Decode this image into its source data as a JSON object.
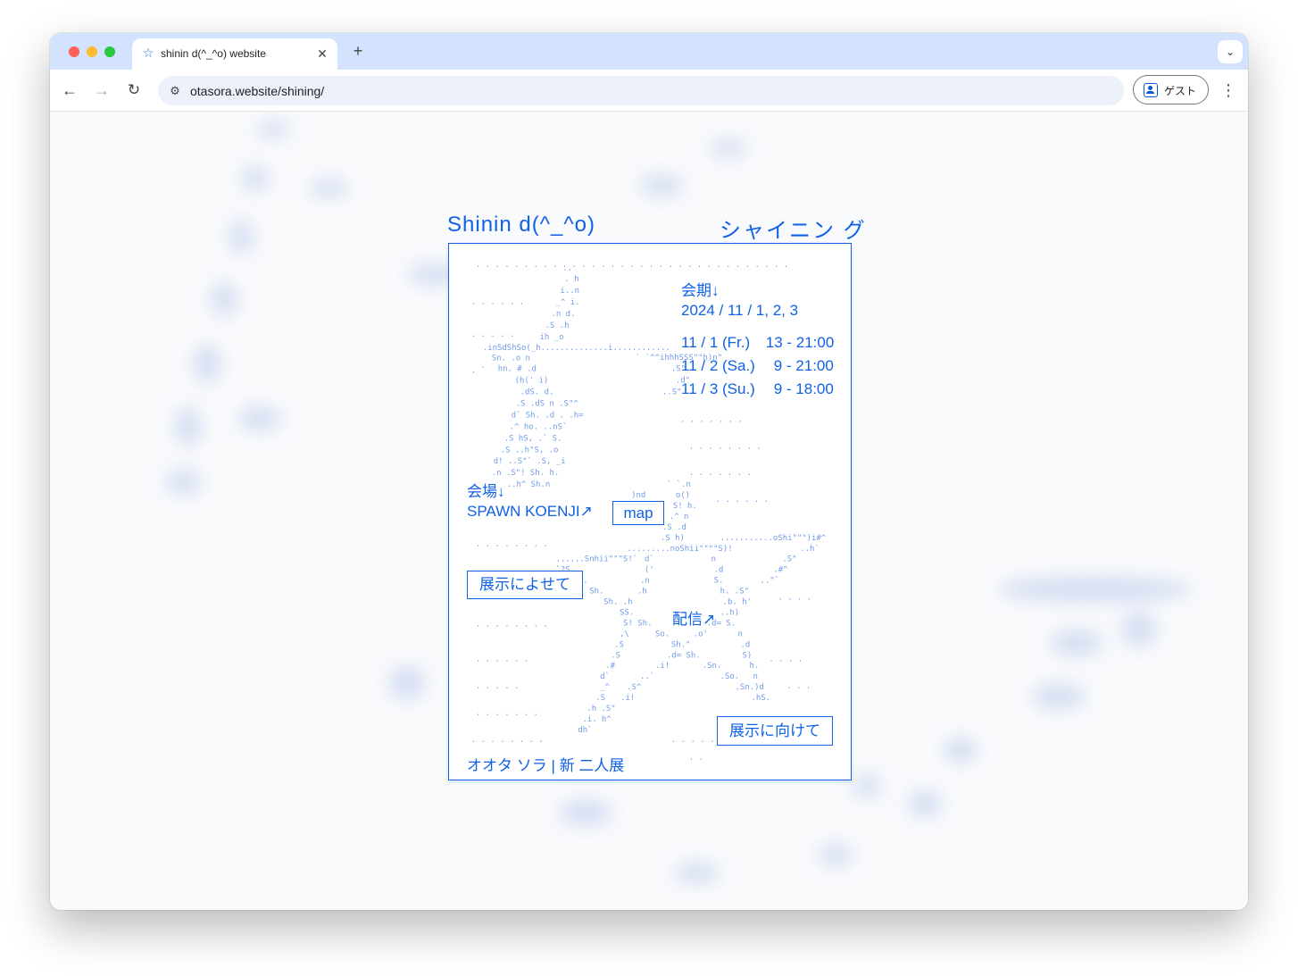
{
  "browser": {
    "tab_title": "shinin d(^_^o) website",
    "tab_favicon": "☆",
    "tab_close": "✕",
    "new_tab": "+",
    "tab_search": "⌄",
    "url": "otasora.website/shining/",
    "guest_label": "ゲスト",
    "nav_back": "←",
    "nav_forward": "→",
    "nav_reload": "↻",
    "site_info_icon": "⚙",
    "menu": "⋮"
  },
  "poster": {
    "title_en": "Shinin d(^_^o)",
    "title_jp": "シャイニン グ",
    "period_label": "会期↓",
    "period_dates": "2024 / 11 / 1, 2, 3",
    "schedule": [
      {
        "day": "11 / 1 (Fr.)",
        "time": "13 - 21:00"
      },
      {
        "day": "11 / 2 (Sa.)",
        "time": "9 - 21:00"
      },
      {
        "day": "11 / 3 (Su.)",
        "time": "9 - 18:00"
      }
    ],
    "venue_label": "会場↓",
    "venue_link": "SPAWN KOENJI↗",
    "map_button": "map",
    "statement_button": "展示によせて",
    "stream_link": "配信↗",
    "toward_button": "展示に向けて",
    "artists": "オオタ ソラ | 新 二人展"
  }
}
